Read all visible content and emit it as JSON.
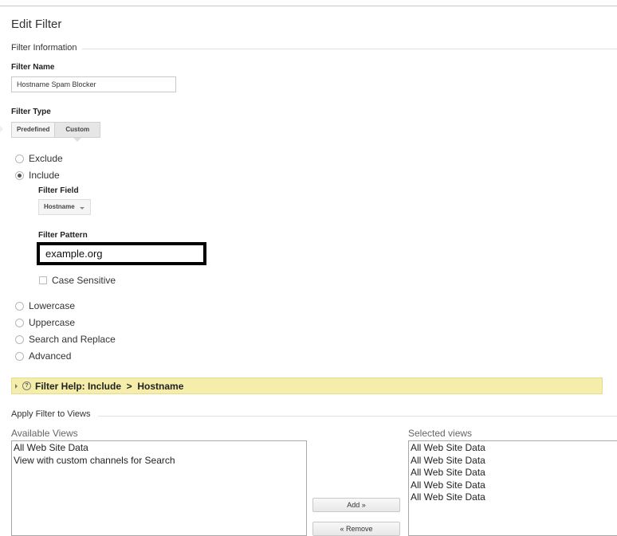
{
  "page": {
    "title": "Edit Filter"
  },
  "filter_information": {
    "section_title": "Filter Information",
    "filter_name_label": "Filter Name",
    "filter_name_value": "Hostname Spam Blocker",
    "filter_type_label": "Filter Type",
    "filter_type_tabs": [
      {
        "label": "Predefined",
        "selected": false
      },
      {
        "label": "Custom",
        "selected": true
      }
    ],
    "radio_options": {
      "exclude": {
        "label": "Exclude",
        "checked": false
      },
      "include": {
        "label": "Include",
        "checked": true
      },
      "lowercase": {
        "label": "Lowercase",
        "checked": false
      },
      "uppercase": {
        "label": "Uppercase",
        "checked": false
      },
      "search_replace": {
        "label": "Search and Replace",
        "checked": false
      },
      "advanced": {
        "label": "Advanced",
        "checked": false
      }
    },
    "filter_field_label": "Filter Field",
    "filter_field_value": "Hostname",
    "filter_pattern_label": "Filter Pattern",
    "filter_pattern_value": "example.org",
    "case_sensitive_label": "Case Sensitive",
    "case_sensitive_checked": false
  },
  "filter_help": {
    "text": "Filter Help: Include  >  Hostname",
    "icon": "question-circle-icon"
  },
  "apply_to_views": {
    "section_title": "Apply Filter to Views",
    "available_label": "Available Views",
    "available_views": [
      "All Web Site Data",
      "View with custom channels for Search"
    ],
    "selected_label": "Selected views",
    "selected_views": [
      "All Web Site Data",
      "All Web Site Data",
      "All Web Site Data",
      "All Web Site Data",
      "All Web Site Data"
    ],
    "add_button": "Add »",
    "remove_button": "« Remove"
  },
  "colors": {
    "help_bar_bg": "#f5eeaa",
    "pattern_border": "#000000"
  }
}
